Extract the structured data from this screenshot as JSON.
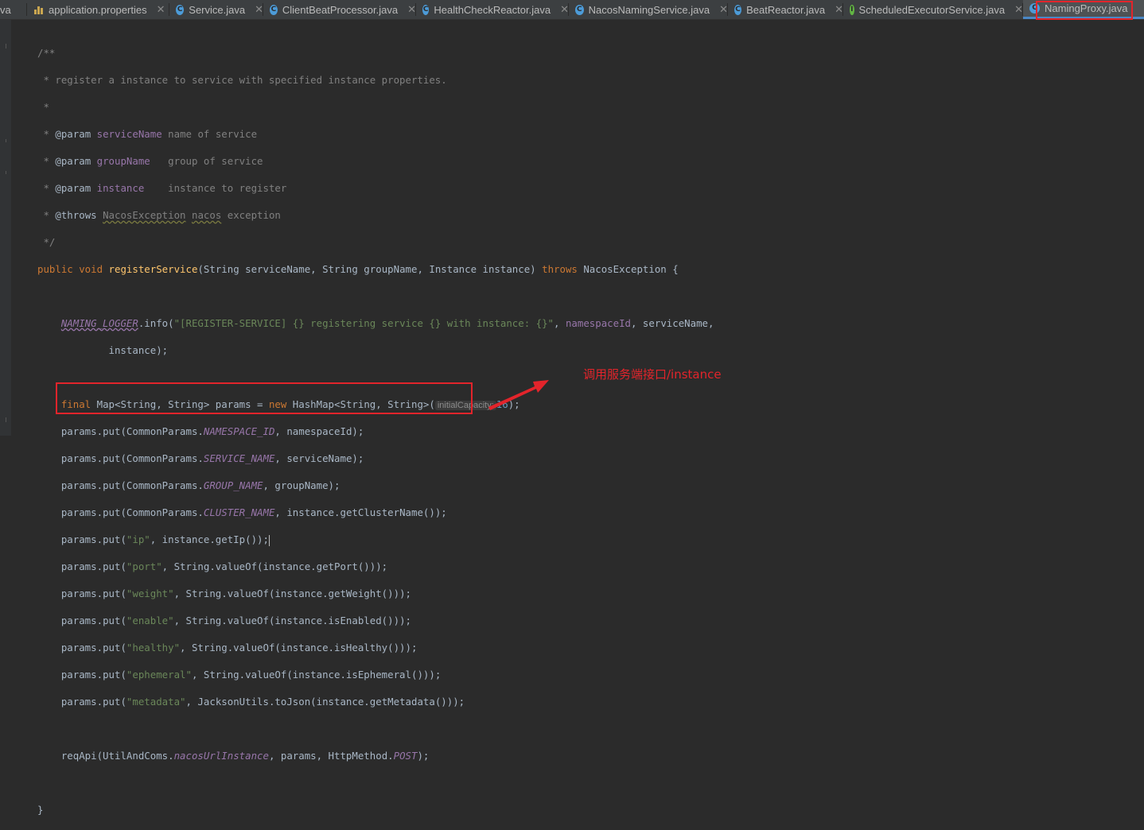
{
  "tabs": [
    {
      "label": "va",
      "icon": "none",
      "active": false
    },
    {
      "label": "application.properties",
      "icon": "properties-file-icon",
      "active": false
    },
    {
      "label": "Service.java",
      "icon": "class-icon",
      "active": false
    },
    {
      "label": "ClientBeatProcessor.java",
      "icon": "class-icon",
      "active": false
    },
    {
      "label": "HealthCheckReactor.java",
      "icon": "class-icon",
      "active": false
    },
    {
      "label": "NacosNamingService.java",
      "icon": "class-icon",
      "active": false
    },
    {
      "label": "BeatReactor.java",
      "icon": "class-icon",
      "active": false
    },
    {
      "label": "ScheduledExecutorService.java",
      "icon": "interface-icon",
      "active": false
    },
    {
      "label": "NamingProxy.java",
      "icon": "class-icon",
      "active": true
    }
  ],
  "code": {
    "doc_open": "/**",
    "doc_desc": " * register a instance to service with specified instance properties.",
    "doc_blank": " *",
    "param1": {
      "prefix": " * ",
      "tag": "@param",
      "name": "serviceName",
      "desc": " name of service"
    },
    "param2": {
      "prefix": " * ",
      "tag": "@param",
      "name": "groupName",
      "desc": "   group of service"
    },
    "param3": {
      "prefix": " * ",
      "tag": "@param",
      "name": "instance",
      "desc": "    instance to register"
    },
    "throws": {
      "prefix": " * ",
      "tag": "@throws",
      "exc": "NacosException",
      "word": "nacos",
      "desc": " exception"
    },
    "doc_close": " */",
    "signature": {
      "mods": "public void ",
      "method": "registerService",
      "params": "(String serviceName, String groupName, Instance instance) ",
      "throws_kw": "throws",
      "exc": " NacosException {"
    },
    "log_line": {
      "indent": "    ",
      "field": "NAMING_LOGGER",
      "call": ".info(",
      "str": "\"[REGISTER-SERVICE] {} registering service {} with instance: {}\"",
      "rest1": ", ",
      "ns": "namespaceId",
      "rest2": ", serviceName,"
    },
    "log_cont": "            instance);",
    "map_line": {
      "indent": "    ",
      "kw": "final",
      "decl": " Map<String, String> params = ",
      "new_kw": "new",
      "ctor": " HashMap<String, String>(",
      "hint": "initialCapacity:",
      "num": "16",
      "end": ");"
    },
    "puts": [
      {
        "key_kind": "const",
        "cls": "CommonParams.",
        "key": "NAMESPACE_ID",
        "val": ", namespaceId);"
      },
      {
        "key_kind": "const",
        "cls": "CommonParams.",
        "key": "SERVICE_NAME",
        "val": ", serviceName);"
      },
      {
        "key_kind": "const",
        "cls": "CommonParams.",
        "key": "GROUP_NAME",
        "val": ", groupName);"
      },
      {
        "key_kind": "const",
        "cls": "CommonParams.",
        "key": "CLUSTER_NAME",
        "val": ", instance.getClusterName());"
      },
      {
        "key_kind": "str",
        "key": "\"ip\"",
        "val": ", instance.getIp());"
      },
      {
        "key_kind": "str",
        "key": "\"port\"",
        "val": ", String.valueOf(instance.getPort()));"
      },
      {
        "key_kind": "str",
        "key": "\"weight\"",
        "val": ", String.valueOf(instance.getWeight()));"
      },
      {
        "key_kind": "str",
        "key": "\"enable\"",
        "val": ", String.valueOf(instance.isEnabled()));"
      },
      {
        "key_kind": "str",
        "key": "\"healthy\"",
        "val": ", String.valueOf(instance.isHealthy()));"
      },
      {
        "key_kind": "str",
        "key": "\"ephemeral\"",
        "val": ", String.valueOf(instance.isEphemeral()));"
      },
      {
        "key_kind": "str",
        "key": "\"metadata\"",
        "val": ", JacksonUtils.toJson(instance.getMetadata()));"
      }
    ],
    "put_prefix": "    params.",
    "put_call": "put(",
    "req_line": {
      "indent": "    ",
      "call": "reqApi(UtilAndComs.",
      "field": "nacosUrlInstance",
      "mid": ", params, HttpMethod.",
      "const": "POST",
      "end": ");"
    },
    "close_brace": "}"
  },
  "annotation": {
    "text": "调用服务端接口/instance",
    "color": "#e3242b"
  }
}
